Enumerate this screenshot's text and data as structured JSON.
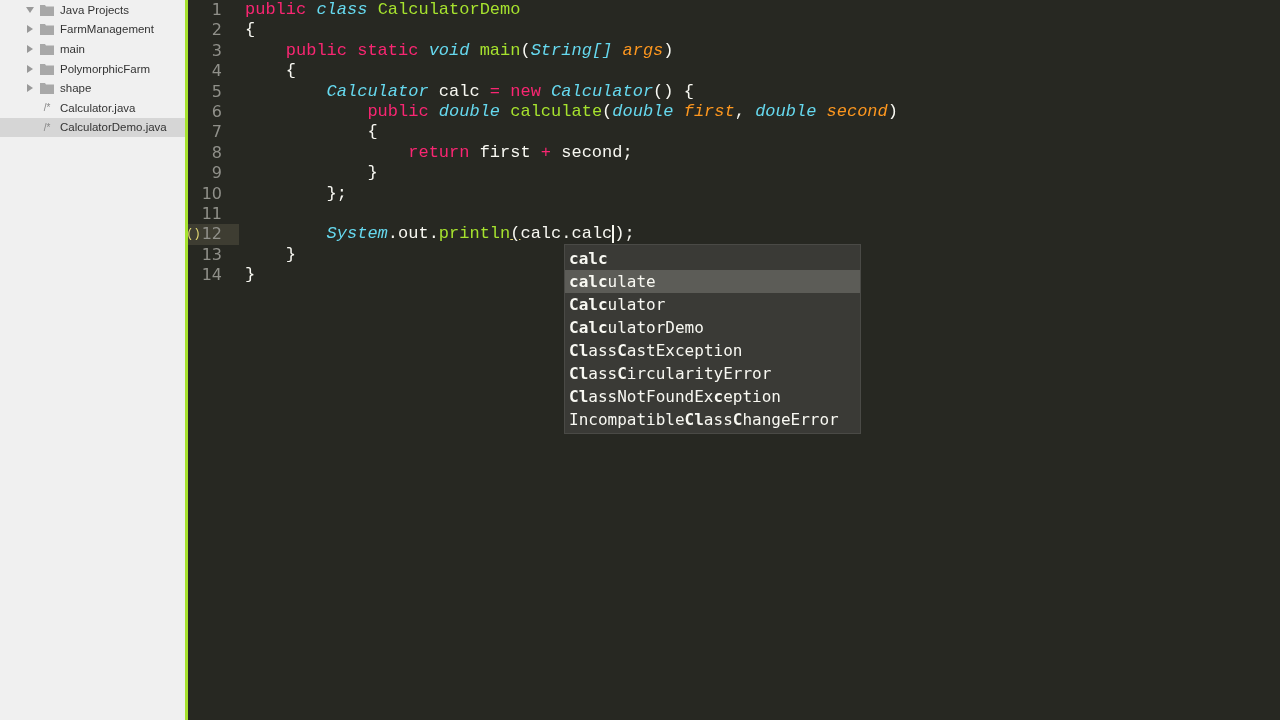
{
  "sidebar": {
    "items": [
      {
        "label": "Java Projects",
        "kind": "folder",
        "expanded": true,
        "selected": false,
        "children": [
          {
            "label": "FarmManagement",
            "kind": "folder",
            "expanded": false,
            "selected": false
          },
          {
            "label": "main",
            "kind": "folder",
            "expanded": false,
            "selected": false
          },
          {
            "label": "PolymorphicFarm",
            "kind": "folder",
            "expanded": false,
            "selected": false
          },
          {
            "label": "shape",
            "kind": "folder",
            "expanded": false,
            "selected": false
          },
          {
            "label": "Calculator.java",
            "kind": "file",
            "icon_text": "/*",
            "selected": false
          },
          {
            "label": "CalculatorDemo.java",
            "kind": "file",
            "icon_text": "/*",
            "selected": true
          }
        ]
      }
    ]
  },
  "editor": {
    "lines": [
      {
        "number": "1",
        "tokens": [
          {
            "t": "public ",
            "kind": "keyword"
          },
          {
            "t": "class ",
            "kind": "type"
          },
          {
            "t": "CalculatorDemo",
            "kind": "function"
          }
        ]
      },
      {
        "number": "2",
        "tokens": [
          {
            "t": "{",
            "kind": "plain"
          }
        ]
      },
      {
        "number": "3",
        "tokens": [
          {
            "t": "    public static ",
            "kind": "keyword"
          },
          {
            "t": "void ",
            "kind": "type"
          },
          {
            "t": "main",
            "kind": "function"
          },
          {
            "t": "(",
            "kind": "plain"
          },
          {
            "t": "String[] ",
            "kind": "type"
          },
          {
            "t": "args",
            "kind": "parameter"
          },
          {
            "t": ")",
            "kind": "plain"
          }
        ]
      },
      {
        "number": "4",
        "tokens": [
          {
            "t": "    {",
            "kind": "plain"
          }
        ]
      },
      {
        "number": "5",
        "tokens": [
          {
            "t": "        Calculator",
            "kind": "type"
          },
          {
            "t": " calc ",
            "kind": "plain"
          },
          {
            "t": "= new ",
            "kind": "keyword"
          },
          {
            "t": "Calculator",
            "kind": "type"
          },
          {
            "t": "() {",
            "kind": "plain"
          }
        ]
      },
      {
        "number": "6",
        "tokens": [
          {
            "t": "            public ",
            "kind": "keyword"
          },
          {
            "t": "double ",
            "kind": "type"
          },
          {
            "t": "calculate",
            "kind": "function"
          },
          {
            "t": "(",
            "kind": "plain"
          },
          {
            "t": "double ",
            "kind": "type"
          },
          {
            "t": "first",
            "kind": "parameter"
          },
          {
            "t": ", ",
            "kind": "plain"
          },
          {
            "t": "double ",
            "kind": "type"
          },
          {
            "t": "second",
            "kind": "parameter"
          },
          {
            "t": ")",
            "kind": "plain"
          }
        ]
      },
      {
        "number": "7",
        "tokens": [
          {
            "t": "            {",
            "kind": "plain"
          }
        ]
      },
      {
        "number": "8",
        "tokens": [
          {
            "t": "                return",
            "kind": "keyword"
          },
          {
            "t": " first ",
            "kind": "plain"
          },
          {
            "t": "+",
            "kind": "keyword"
          },
          {
            "t": " second;",
            "kind": "plain"
          }
        ]
      },
      {
        "number": "9",
        "tokens": [
          {
            "t": "            }",
            "kind": "plain"
          }
        ]
      },
      {
        "number": "10",
        "tokens": [
          {
            "t": "        };",
            "kind": "plain"
          }
        ]
      },
      {
        "number": "11"
      },
      {
        "number": "12",
        "current": true,
        "gutter_mark": "()",
        "tokens": [
          {
            "t": "        System",
            "kind": "type"
          },
          {
            "t": ".out.",
            "kind": "plain"
          },
          {
            "t": "println",
            "kind": "function"
          },
          {
            "t": "(",
            "kind": "plain",
            "underline": true
          },
          {
            "t": "calc.calc",
            "kind": "plain",
            "caret_after": true
          },
          {
            "t": ");",
            "kind": "plain"
          }
        ]
      },
      {
        "number": "13",
        "tokens": [
          {
            "t": "    }",
            "kind": "plain"
          }
        ]
      },
      {
        "number": "14",
        "tokens": [
          {
            "t": "}",
            "kind": "plain"
          }
        ]
      }
    ],
    "completions": [
      {
        "label": "**calc**",
        "selected": false
      },
      {
        "label": "**calc**ulate",
        "selected": true
      },
      {
        "label": "**Calc**ulator",
        "selected": false
      },
      {
        "label": "**Calc**ulatorDemo",
        "selected": false
      },
      {
        "label": "**Cl**ass**C**astException",
        "selected": false
      },
      {
        "label": "**Cl**ass**C**ircularityError",
        "selected": false
      },
      {
        "label": "**Cl**assNotFoundEx**c**eption",
        "selected": false
      },
      {
        "label": "Incompatible**Cl**ass**C**hangeError",
        "selected": false
      }
    ]
  }
}
